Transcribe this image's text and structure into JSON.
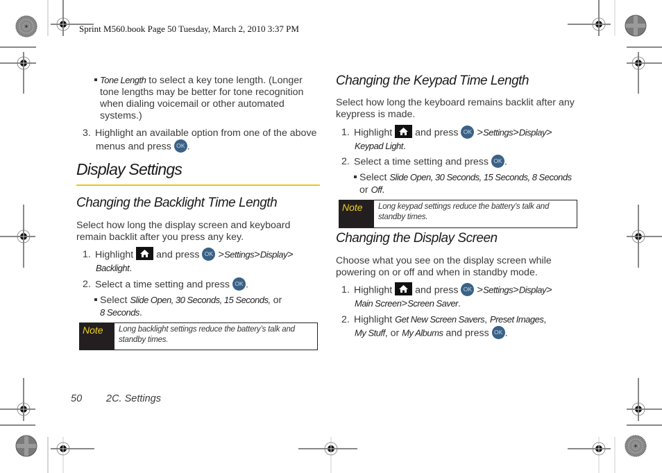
{
  "slug": "Sprint M560.book  Page 50  Tuesday, March 2, 2010  3:37 PM",
  "left_column": {
    "tone_bullet": {
      "term": "Tone Length",
      "text_line1": " to select a key tone length. (Longer",
      "text_line2": "tone lengths may be better for tone recognition",
      "text_line3": "when dialing voicemail or other automated",
      "text_line4": "systems.)"
    },
    "step3": {
      "number": "3.",
      "line1": "Highlight an available option from one of the above",
      "line2": "menus and press",
      "ok": "OK",
      "end": "."
    },
    "section_title": "Display Settings",
    "backlight": {
      "title": "Changing the Backlight Time Length",
      "intro_line1": "Select how long the display screen and keyboard",
      "intro_line2": "remain backlit after you press any key.",
      "step1": {
        "number": "1.",
        "highlight": "Highlight",
        "and_press": "and press",
        "ok": "OK",
        "path1": "Settings",
        "path2": "Display",
        "path3": "Backlight",
        "gt": ">",
        "end": "."
      },
      "step2": {
        "number": "2.",
        "text": "Select a time setting and press",
        "ok": "OK",
        "end": "."
      },
      "bullet": {
        "select": "Select",
        "options": "Slide Open, 30 Seconds, 15 Seconds,",
        "or": "or",
        "last": "8 Seconds",
        "end": "."
      },
      "note": {
        "label": "Note",
        "line1": "Long backlight settings reduce the battery’s talk and",
        "line2": "standby times."
      }
    }
  },
  "right_column": {
    "keypad": {
      "title": "Changing the Keypad Time Length",
      "intro_line1": "Select how long the keyboard remains backlit after any",
      "intro_line2": "keypress is made.",
      "step1": {
        "number": "1.",
        "highlight": "Highlight",
        "and_press": "and press",
        "ok": "OK",
        "path1": "Settings",
        "path2": "Display",
        "path3": "Keypad Light",
        "gt": ">",
        "end": "."
      },
      "step2": {
        "number": "2.",
        "text": "Select a time setting and press",
        "ok": "OK",
        "end": "."
      },
      "bullet": {
        "select": "Select",
        "options": "Slide Open, 30 Seconds, 15 Seconds, 8 Seconds",
        "or": "or",
        "last": "Off",
        "end": "."
      },
      "note": {
        "label": "Note",
        "line1": "Long keypad settings reduce the battery’s talk and",
        "line2": "standby times."
      }
    },
    "display_screen": {
      "title": "Changing the Display Screen",
      "intro_line1": "Choose what you see on the display screen while",
      "intro_line2": "powering on or off and when in standby mode.",
      "step1": {
        "number": "1.",
        "highlight": "Highlight",
        "and_press": "and press",
        "ok": "OK",
        "path1": "Settings",
        "path2": "Display",
        "path3": "Main Screen",
        "path4": "Screen Saver",
        "gt": ">",
        "end": "."
      },
      "step2": {
        "number": "2.",
        "highlight": "Highlight",
        "opt1": "Get New Screen Savers",
        "comma": ",",
        "opt2": "Preset Images",
        "opt3": "My Stuff",
        "or": ", or",
        "opt4": "My Albums",
        "and_press": "and press",
        "ok": "OK",
        "end": "."
      }
    }
  },
  "footer": {
    "page_number": "50",
    "section": "2C. Settings"
  },
  "colors": {
    "accent_rule": "#e6c81c",
    "note_label_text": "#f0d21c",
    "note_label_bg": "#231f20",
    "ok_button": "#3a6186"
  }
}
